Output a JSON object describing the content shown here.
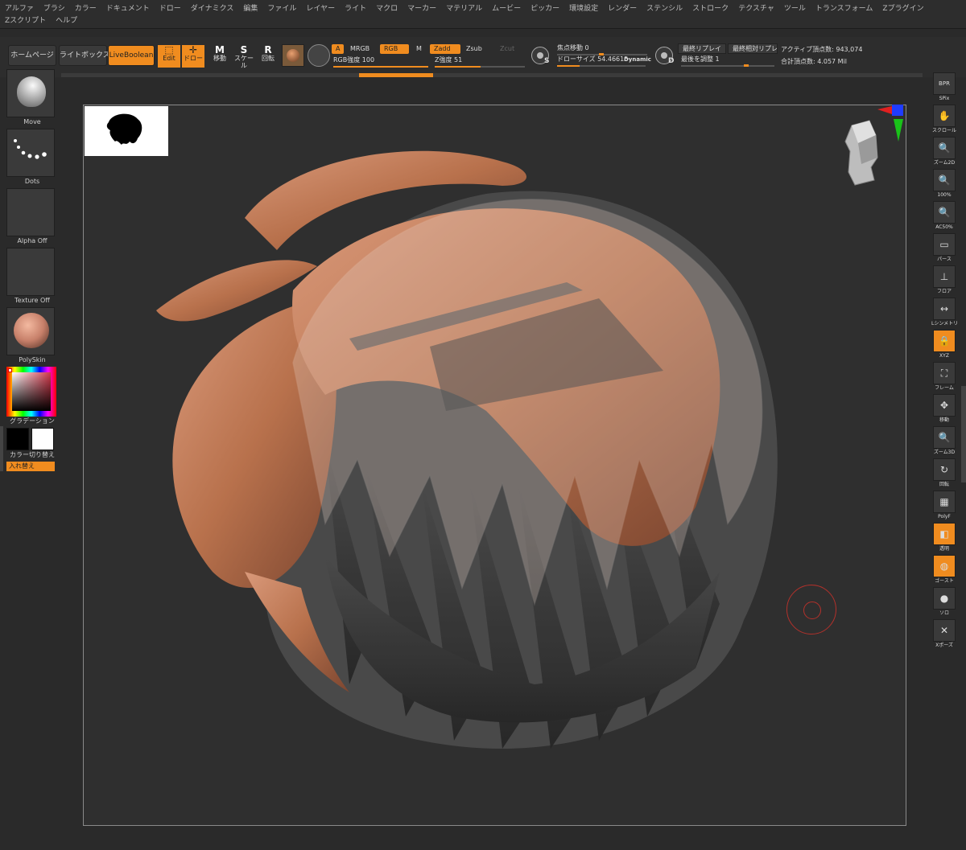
{
  "menu": {
    "items": [
      "アルファ",
      "ブラシ",
      "カラー",
      "ドキュメント",
      "ドロー",
      "ダイナミクス",
      "編集",
      "ファイル",
      "レイヤー",
      "ライト",
      "マクロ",
      "マーカー",
      "マテリアル",
      "ムービー",
      "ピッカー",
      "環境設定",
      "レンダー",
      "ステンシル",
      "ストローク",
      "テクスチャ",
      "ツール",
      "トランスフォーム",
      "Zプラグイン",
      "Zスクリプト",
      "ヘルプ"
    ]
  },
  "toolbar": {
    "home_label": "ホームページ",
    "lightbox_label": "ライトボックス",
    "liveboolean_label": "LiveBoolean",
    "edit_label": "Edit",
    "draw_label": "ドロー",
    "move_label": "移動",
    "scale_label": "スケール",
    "rotate_label": "回転",
    "move_glyph": "M",
    "scale_glyph": "S",
    "rotate_glyph": "R",
    "a_label": "A",
    "mrgb_label": "MRGB",
    "rgb_label": "RGB",
    "m_label": "M",
    "zadd_label": "Zadd",
    "zsub_label": "Zsub",
    "zcut_label": "Zcut",
    "rgb_intensity": "RGB強度 100",
    "rgb_intensity_value": 100,
    "z_intensity": "Z強度 51",
    "z_intensity_value": 51,
    "focal_shift": "焦点移動 0",
    "focal_shift_value": 0,
    "draw_size": "ドローサイズ 54.46615",
    "draw_size_value": 54.46615,
    "dynamic_label": "Dynamic",
    "s_label": "S",
    "d_label": "D",
    "last_replay": "最終リプレイ",
    "last_relative_replay": "最終相対リプレ",
    "adjust_last": "最後を調整 1",
    "active_points": "アクティブ頂点数: 943,074",
    "total_points": "合計頂点数: 4.057 Mil"
  },
  "left": {
    "tiles": [
      {
        "label": "Move"
      },
      {
        "label": "Dots"
      },
      {
        "label": "Alpha Off"
      },
      {
        "label": "Texture Off"
      },
      {
        "label": "PolySkin"
      }
    ],
    "gradient_label": "グラデーション",
    "switch_color_label": "カラー切り替え",
    "swap_label": "入れ替え"
  },
  "right": {
    "items": [
      {
        "label": "SPix",
        "glyph": "BPR",
        "active": false
      },
      {
        "label": "スクロール",
        "glyph": "✋",
        "active": false
      },
      {
        "label": "ズーム2D",
        "glyph": "🔍",
        "active": false
      },
      {
        "label": "100%",
        "glyph": "🔍",
        "active": false
      },
      {
        "label": "AC50%",
        "glyph": "🔍",
        "active": false
      },
      {
        "label": "パース",
        "glyph": "▭",
        "active": false
      },
      {
        "label": "フロア",
        "glyph": "⊥",
        "active": false
      },
      {
        "label": "Lシンメトリ",
        "glyph": "↔",
        "active": false
      },
      {
        "label": "XYZ",
        "glyph": "🔒",
        "active": true
      },
      {
        "label": "フレーム",
        "glyph": "⛶",
        "active": false
      },
      {
        "label": "移動",
        "glyph": "✥",
        "active": false
      },
      {
        "label": "ズーム3D",
        "glyph": "🔍",
        "active": false
      },
      {
        "label": "回転",
        "glyph": "↻",
        "active": false
      },
      {
        "label": "PolyF",
        "glyph": "▦",
        "active": false
      },
      {
        "label": "透明",
        "glyph": "◧",
        "active": true
      },
      {
        "label": "ゴースト",
        "glyph": "◍",
        "active": true
      },
      {
        "label": "ソロ",
        "glyph": "●",
        "active": false
      },
      {
        "label": "Xポーズ",
        "glyph": "✕",
        "active": false
      }
    ]
  },
  "colors": {
    "accent": "#f08c1f",
    "hair_copper": "#c98662",
    "hair_dark": "#3c3c3c",
    "bg": "#2f2f2f"
  }
}
